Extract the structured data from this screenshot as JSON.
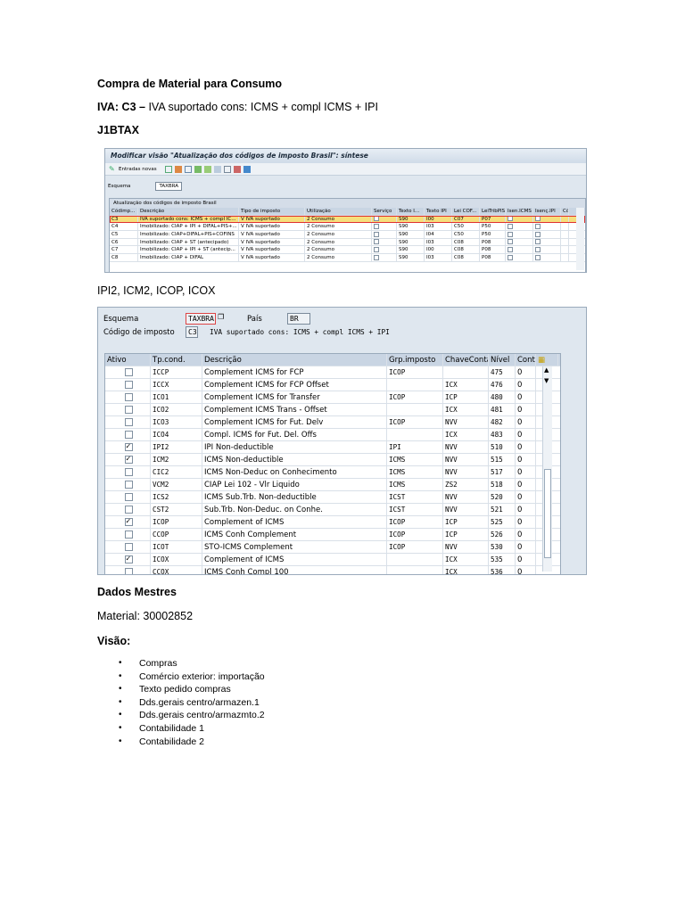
{
  "doc": {
    "title": "Compra de Material para Consumo",
    "iva_label": "IVA: C3 –",
    "iva_text": "IVA suportado cons: ICMS + compl ICMS + IPI",
    "j1btax": "J1BTAX",
    "section2_heading": "IPI2, ICM2, ICOP, ICOX",
    "dados_mestres": "Dados Mestres",
    "material": "Material: 30002852",
    "visao": "Visão:",
    "visao_items": [
      "Compras",
      "Comércio exterior: importação",
      "Texto pedido compras",
      "Dds.gerais centro/armazen.1",
      "Dds.gerais centro/armazmto.2",
      "Contabilidade 1",
      "Contabilidade 2"
    ]
  },
  "shot1": {
    "title": "Modificar visão \"Atualização dos códigos de imposto Brasil\": síntese",
    "toolbar_label": "Entradas novas",
    "scheme_label": "Esquema",
    "scheme_value": "TAXBRA",
    "grid_title": "Atualização dos códigos de imposto Brasil",
    "headers": [
      "Códimp...",
      "Descrição",
      "Tipo de imposto",
      "Utilização",
      "Serviço",
      "Texto I...",
      "Texto IPI",
      "Lei COF...",
      "LeiTribPIS",
      "Isen.ICMS",
      "Isenç.IPI",
      "Cód"
    ],
    "rows": [
      [
        "C3",
        "IVA suportado cons: ICMS + compl IC...",
        "V IVA suportado",
        "2 Consumo",
        "S90",
        "I00",
        "C07",
        "P07"
      ],
      [
        "C4",
        "Imobilizado: CIAP + IPI + DIFAL+PIS+...",
        "V IVA suportado",
        "2 Consumo",
        "S90",
        "I03",
        "C50",
        "P50"
      ],
      [
        "C5",
        "Imobilizado: CIAP+DIFAL+PIS+COFINS",
        "V IVA suportado",
        "2 Consumo",
        "S90",
        "I04",
        "C50",
        "P50"
      ],
      [
        "C6",
        "Imobilizado: CIAP + ST (antecipado)",
        "V IVA suportado",
        "2 Consumo",
        "S90",
        "I03",
        "C08",
        "P08"
      ],
      [
        "C7",
        "Imobilizado: CIAP + IPI + ST (antecip...",
        "V IVA suportado",
        "2 Consumo",
        "S90",
        "I00",
        "C08",
        "P08"
      ],
      [
        "C8",
        "Imobilizado: CIAP + DIFAL",
        "V IVA suportado",
        "2 Consumo",
        "S90",
        "I03",
        "C08",
        "P08"
      ]
    ]
  },
  "shot2": {
    "scheme_label": "Esquema",
    "scheme_value": "TAXBRA",
    "country_label": "País",
    "country_value": "BR",
    "taxcode_label": "Código de imposto",
    "taxcode_value": "C3",
    "taxcode_text": "IVA suportado cons: ICMS + compl ICMS + IPI",
    "headers": [
      "Ativo",
      "Tp.cond.",
      "Descrição",
      "Grp.imposto",
      "ChaveConta",
      "Nível",
      "Cont"
    ],
    "rows": [
      {
        "active": false,
        "cond": "ICCP",
        "desc": "Complement ICMS for FCP",
        "grp": "ICOP",
        "key": "",
        "level": "475",
        "cont": "0"
      },
      {
        "active": false,
        "cond": "ICCX",
        "desc": "Complement ICMS for FCP Offset",
        "grp": "",
        "key": "ICX",
        "level": "476",
        "cont": "0"
      },
      {
        "active": false,
        "cond": "ICO1",
        "desc": "Complement ICMS for Transfer",
        "grp": "ICOP",
        "key": "ICP",
        "level": "480",
        "cont": "0"
      },
      {
        "active": false,
        "cond": "ICO2",
        "desc": "Complement ICMS Trans - Offset",
        "grp": "",
        "key": "ICX",
        "level": "481",
        "cont": "0"
      },
      {
        "active": false,
        "cond": "ICO3",
        "desc": "Complement ICMS for Fut. Delv",
        "grp": "ICOP",
        "key": "NVV",
        "level": "482",
        "cont": "0"
      },
      {
        "active": false,
        "cond": "ICO4",
        "desc": "Compl. ICMS for Fut. Del. Offs",
        "grp": "",
        "key": "ICX",
        "level": "483",
        "cont": "0"
      },
      {
        "active": true,
        "cond": "IPI2",
        "desc": "IPI  Non-deductible",
        "grp": "IPI",
        "key": "NVV",
        "level": "510",
        "cont": "0"
      },
      {
        "active": true,
        "cond": "ICM2",
        "desc": "ICMS Non-deductible",
        "grp": "ICMS",
        "key": "NVV",
        "level": "515",
        "cont": "0"
      },
      {
        "active": false,
        "cond": "CIC2",
        "desc": "ICMS Non-Deduc on Conhecimento",
        "grp": "ICMS",
        "key": "NVV",
        "level": "517",
        "cont": "0"
      },
      {
        "active": false,
        "cond": "VCM2",
        "desc": "CIAP Lei 102 - Vlr Liquido",
        "grp": "ICMS",
        "key": "ZS2",
        "level": "518",
        "cont": "0"
      },
      {
        "active": false,
        "cond": "ICS2",
        "desc": "ICMS Sub.Trb. Non-deductible",
        "grp": "ICST",
        "key": "NVV",
        "level": "520",
        "cont": "0"
      },
      {
        "active": false,
        "cond": "CST2",
        "desc": "Sub.Trb. Non-Deduc. on Conhe.",
        "grp": "ICST",
        "key": "NVV",
        "level": "521",
        "cont": "0"
      },
      {
        "active": true,
        "cond": "ICOP",
        "desc": "Complement of ICMS",
        "grp": "ICOP",
        "key": "ICP",
        "level": "525",
        "cont": "0"
      },
      {
        "active": false,
        "cond": "CCOP",
        "desc": "ICMS Conh Complement",
        "grp": "ICOP",
        "key": "ICP",
        "level": "526",
        "cont": "0"
      },
      {
        "active": false,
        "cond": "ICOT",
        "desc": "STO-ICMS Complement",
        "grp": "ICOP",
        "key": "NVV",
        "level": "530",
        "cont": "0"
      },
      {
        "active": true,
        "cond": "ICOX",
        "desc": "Complement of ICMS",
        "grp": "",
        "key": "ICX",
        "level": "535",
        "cont": "0"
      },
      {
        "active": false,
        "cond": "CCOX",
        "desc": "ICMS Conh Compl 100",
        "grp": "",
        "key": "ICX",
        "level": "536",
        "cont": "0"
      }
    ]
  }
}
